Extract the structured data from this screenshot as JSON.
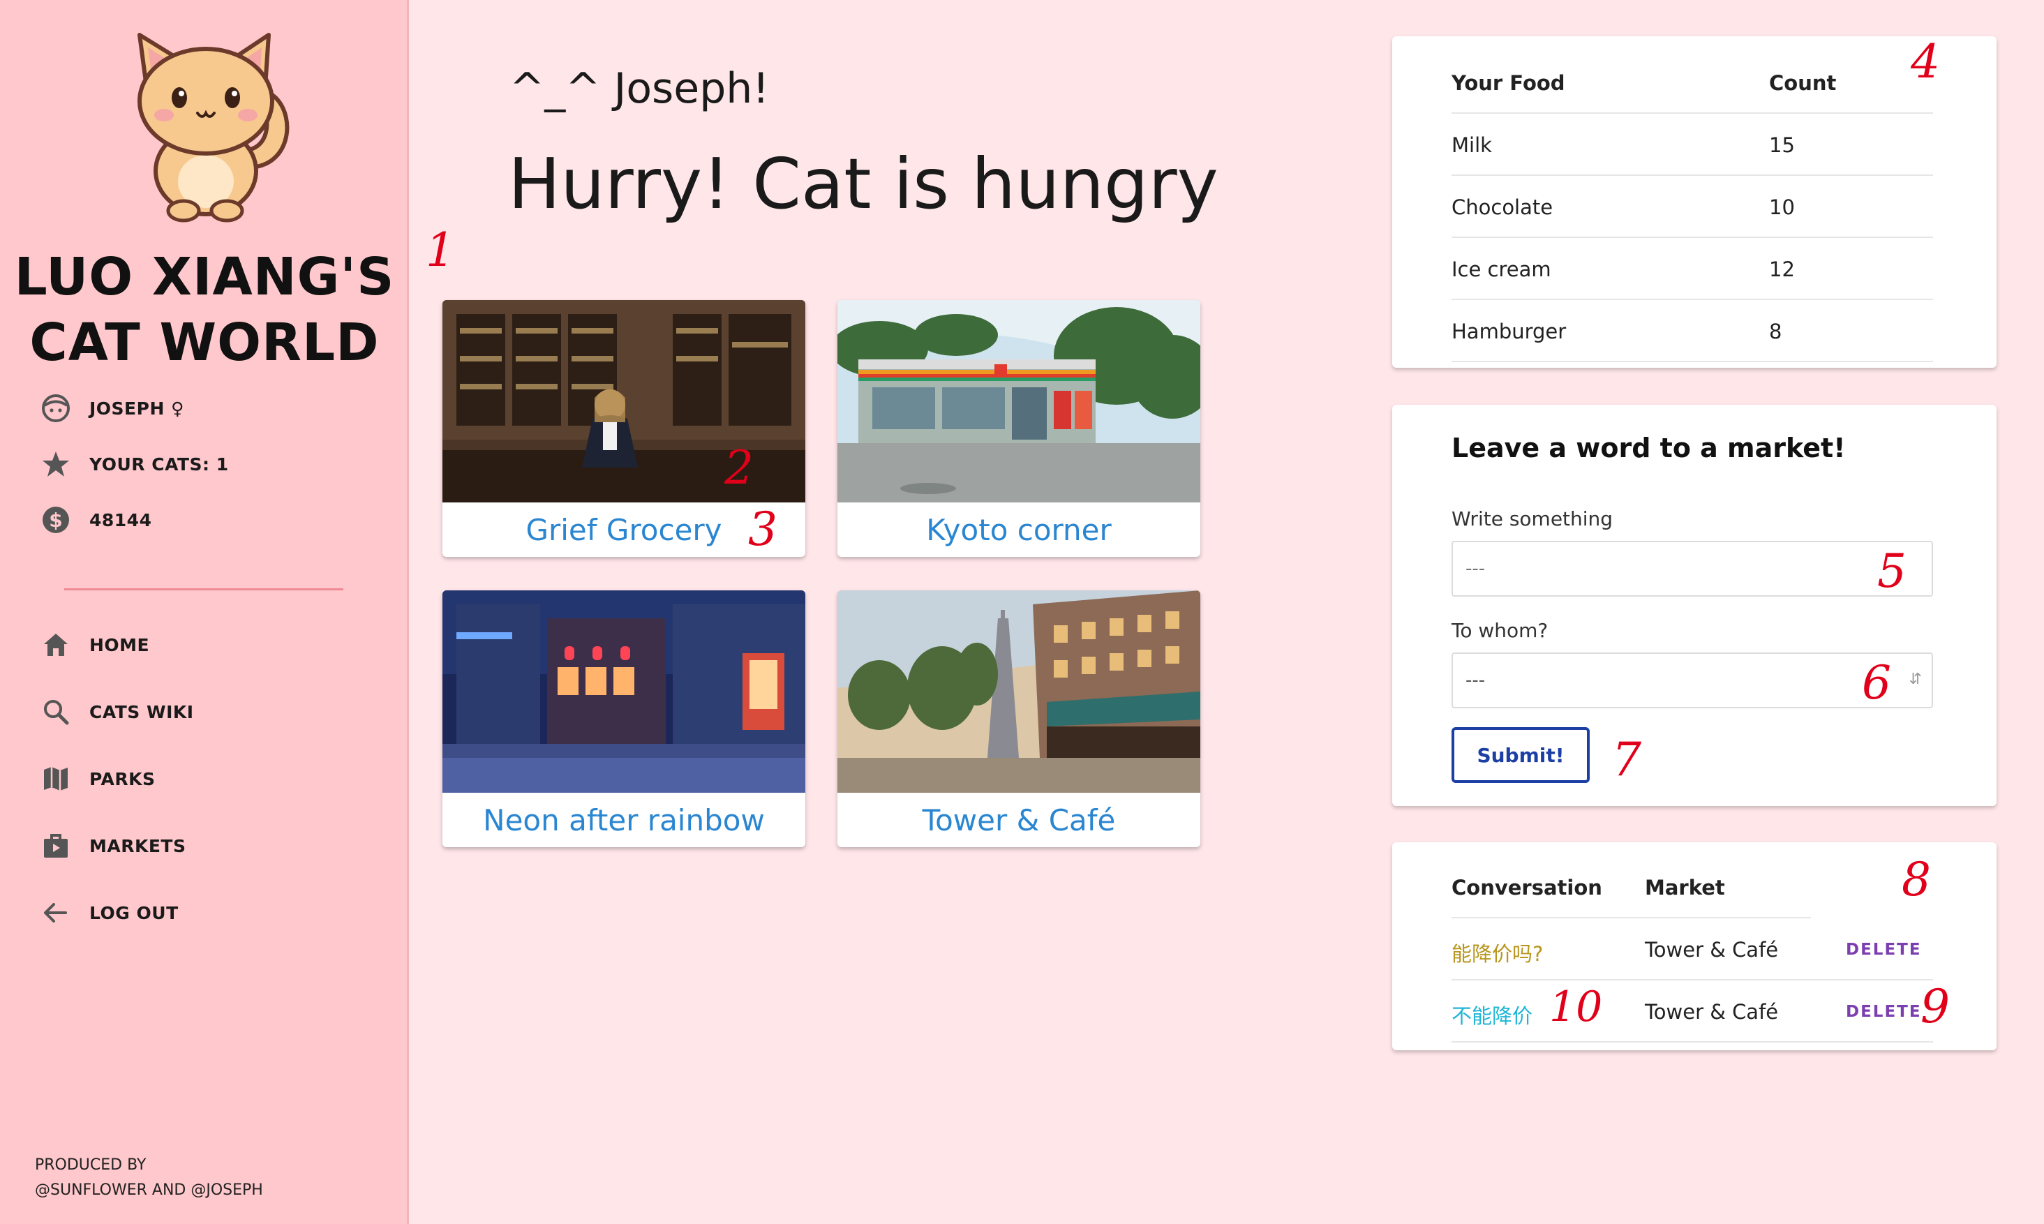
{
  "sidebar": {
    "brand_line1": "LUO XIANG'S",
    "brand_line2": "CAT WORLD",
    "profile": {
      "user_name": "JOSEPH ♀",
      "cats": "YOUR CATS: 1",
      "money": "48144"
    },
    "nav": [
      {
        "label": "HOME",
        "icon": "home-icon"
      },
      {
        "label": "CATS WIKI",
        "icon": "search-icon"
      },
      {
        "label": "PARKS",
        "icon": "map-icon"
      },
      {
        "label": "MARKETS",
        "icon": "shop-icon"
      },
      {
        "label": "LOG OUT",
        "icon": "arrow-left-icon"
      }
    ],
    "credits_line1": "PRODUCED BY",
    "credits_line2": "@SUNFLOWER AND @JOSEPH"
  },
  "main": {
    "greeting": "^_^ Joseph!",
    "headline": "Hurry! Cat is hungry",
    "markets": [
      {
        "name": "Grief Grocery"
      },
      {
        "name": "Kyoto corner"
      },
      {
        "name": "Neon after rainbow"
      },
      {
        "name": "Tower & Café"
      }
    ]
  },
  "food_table": {
    "headers": [
      "Your Food",
      "Count"
    ],
    "rows": [
      [
        "Milk",
        "15"
      ],
      [
        "Chocolate",
        "10"
      ],
      [
        "Ice cream",
        "12"
      ],
      [
        "Hamburger",
        "8"
      ]
    ]
  },
  "note_form": {
    "title": "Leave a word to a market!",
    "message_label": "Write something",
    "message_placeholder": "---",
    "recipient_label": "To whom?",
    "recipient_value": "---",
    "submit_label": "Submit!"
  },
  "conversation_table": {
    "headers": [
      "Conversation",
      "Market"
    ],
    "rows": [
      {
        "text": "能降价吗?",
        "market": "Tower & Café",
        "action": "DELETE"
      },
      {
        "text": "不能降价",
        "market": "Tower & Café",
        "action": "DELETE"
      }
    ]
  },
  "annotations": [
    "1",
    "2",
    "3",
    "4",
    "5",
    "6",
    "7",
    "8",
    "9",
    "10"
  ],
  "colors": {
    "sidebar_bg": "#ffc8cc",
    "page_bg": "#ffe6e9",
    "market_name": "#2a86d1",
    "submit_border": "#1c3fa6",
    "delete_link": "#7b3fb0",
    "conversation_1": "#b8961e",
    "conversation_2": "#1fb6d6",
    "annotation": "#e1001a"
  }
}
